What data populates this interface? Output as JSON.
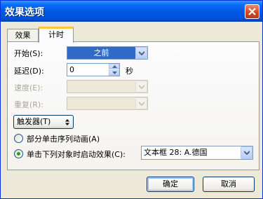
{
  "window": {
    "title": "效果选项"
  },
  "tabs": [
    {
      "label": "效果"
    },
    {
      "label": "计时"
    }
  ],
  "timing": {
    "start": {
      "label": "开始(S):",
      "value": "之前"
    },
    "delay": {
      "label": "延迟(D):",
      "value": "0",
      "unit": "秒"
    },
    "speed": {
      "label": "速度(E):",
      "value": ""
    },
    "repeat": {
      "label": "重复(R):",
      "value": ""
    }
  },
  "triggers": {
    "button_label": "触发器(T)",
    "option_sequence": "部分单击序列动画(A)",
    "option_object": "单击下列对象时启动效果(C):",
    "selected_option": "object",
    "object_value": "文本框 28: A.德国"
  },
  "footer": {
    "ok_label": "确定",
    "cancel_label": "取消"
  },
  "colors": {
    "titlebar": "#0058e6",
    "selection": "#316ac5",
    "active_tab_accent": "#ffc83c"
  },
  "icons": {
    "close": "close-icon",
    "dropdown": "chevron-down-icon",
    "spin_up": "arrow-up-icon",
    "spin_down": "arrow-down-icon",
    "trigger_toggle": "up-down-arrow-icon"
  }
}
